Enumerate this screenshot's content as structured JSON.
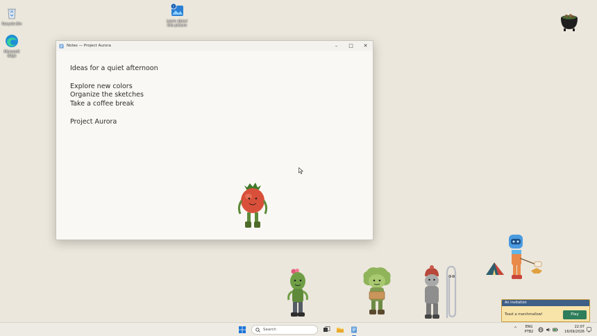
{
  "desktop": {
    "icons": [
      {
        "label": "Recycle Bin",
        "icon": "recycle-bin-icon"
      },
      {
        "label": "Microsoft\nEdge",
        "icon": "edge-icon"
      },
      {
        "label": "Learn about\nthis picture",
        "icon": "info-picture-icon"
      }
    ]
  },
  "window": {
    "title": "Notes — Project Aurora",
    "controls": {
      "minimize": "–",
      "maximize": "□",
      "close": "✕"
    },
    "lines": [
      "Ideas for a quiet afternoon",
      "",
      "Explore new colors",
      "Organize the sketches",
      "Take a coffee break",
      "",
      "Project Aurora"
    ]
  },
  "notification": {
    "title": "An invitation",
    "message": "Toast a marshmallow!",
    "action": "Play"
  },
  "taskbar": {
    "search_placeholder": "Search",
    "apps": [
      "start-icon",
      "task-view-icon",
      "file-explorer-icon",
      "notepad-icon"
    ],
    "tray": {
      "lang_top": "ENG",
      "lang_bottom": "PTB2",
      "time": "22:07",
      "date": "16/09/2026",
      "chevron": "^"
    }
  },
  "colors": {
    "desktop": "#ebe7dc",
    "toast_header": "#3f5f87",
    "toast_body": "#f8e3a9",
    "play_button": "#2e7d5b",
    "accent": "#2a6bd1"
  }
}
